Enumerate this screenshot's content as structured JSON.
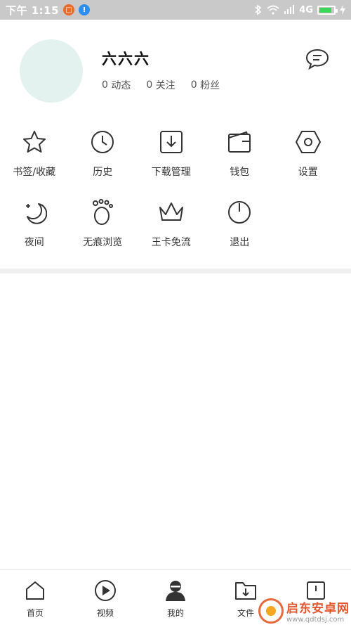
{
  "statusbar": {
    "time": "下午 1:15",
    "network": "4G",
    "app_badge_1": "□",
    "app_badge_2": "!"
  },
  "profile": {
    "username": "六六六",
    "stats": [
      {
        "count": "0",
        "label": "动态"
      },
      {
        "count": "0",
        "label": "关注"
      },
      {
        "count": "0",
        "label": "粉丝"
      }
    ]
  },
  "menu": {
    "row1": [
      {
        "label": "书签/收藏",
        "icon": "star-icon"
      },
      {
        "label": "历史",
        "icon": "clock-icon"
      },
      {
        "label": "下载管理",
        "icon": "download-icon"
      },
      {
        "label": "钱包",
        "icon": "wallet-icon"
      },
      {
        "label": "设置",
        "icon": "settings-icon"
      }
    ],
    "row2": [
      {
        "label": "夜间",
        "icon": "moon-icon"
      },
      {
        "label": "无痕浏览",
        "icon": "footprint-icon"
      },
      {
        "label": "王卡免流",
        "icon": "crown-icon"
      },
      {
        "label": "退出",
        "icon": "power-icon"
      }
    ]
  },
  "tabs": [
    {
      "label": "首页",
      "icon": "home-icon"
    },
    {
      "label": "视频",
      "icon": "play-icon"
    },
    {
      "label": "我的",
      "icon": "user-icon"
    },
    {
      "label": "文件",
      "icon": "folder-download-icon"
    },
    {
      "label": "",
      "icon": "card-icon"
    }
  ],
  "watermark": {
    "main": "启东安卓网",
    "sub": "www.qdtdsj.com"
  },
  "colors": {
    "accent_battery": "#3ad65a",
    "avatar_bg": "#e3f2ee",
    "statusbar_bg": "#c9c9c9"
  }
}
